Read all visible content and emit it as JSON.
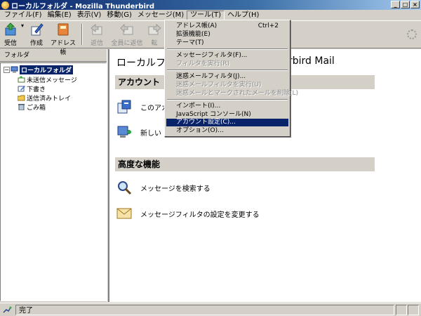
{
  "window": {
    "title": "ローカルフォルダ - Mozilla Thunderbird",
    "min": "_",
    "max": "□",
    "close": "×"
  },
  "menubar": [
    {
      "label": "ファイル(F)"
    },
    {
      "label": "編集(E)"
    },
    {
      "label": "表示(V)"
    },
    {
      "label": "移動(G)"
    },
    {
      "label": "メッセージ(M)"
    },
    {
      "label": "ツール(T)",
      "active": true
    },
    {
      "label": "ヘルプ(H)"
    }
  ],
  "toolbar": {
    "get": "受信",
    "compose": "作成",
    "address_book": "アドレス帳",
    "reply": "返信",
    "reply_all": "全員に返信",
    "forward": "転"
  },
  "folder_pane": {
    "header": "フォルダ",
    "expander": "−",
    "items": [
      "ローカルフォルダ",
      "未送信メッセージ",
      "下書き",
      "送信済みトレイ",
      "ごみ箱"
    ]
  },
  "main": {
    "title": "ローカルフ",
    "title_tail": "rbird Mail",
    "accounts_header": "アカウント",
    "account_settings_link": "このアカ",
    "new_account_link": "新しい",
    "advanced_header": "高度な機能",
    "search_link": "メッセージを検索する",
    "filters_link": "メッセージフィルタの設定を変更する"
  },
  "tools_menu": {
    "items": [
      {
        "label": "アドレス帳(A)",
        "shortcut": "Ctrl+2",
        "enabled": true
      },
      {
        "label": "拡張機能(E)",
        "enabled": true
      },
      {
        "label": "テーマ(T)",
        "enabled": true
      },
      {
        "separator": true
      },
      {
        "label": "メッセージフィルタ(F)...",
        "enabled": true
      },
      {
        "label": "フィルタを実行(R)",
        "enabled": false
      },
      {
        "separator": true
      },
      {
        "label": "迷惑メールフィルタ(J)...",
        "enabled": true
      },
      {
        "label": "迷惑メールフィルタを実行(U)",
        "enabled": false
      },
      {
        "label": "迷惑メールとマークされたメールを削除(L)",
        "enabled": false
      },
      {
        "separator": true
      },
      {
        "label": "インポート(I)...",
        "enabled": true
      },
      {
        "label": "JavaScript コンソール(N)",
        "enabled": true
      },
      {
        "separator": true
      },
      {
        "label": "アカウント設定(C)...",
        "enabled": true,
        "highlighted": true
      },
      {
        "label": "オプション(O)...",
        "enabled": true
      }
    ]
  },
  "status": {
    "text": "完了"
  },
  "colors": {
    "selection": "#0a246a",
    "face": "#d4d0c8",
    "titlebar_start": "#0a246a",
    "titlebar_end": "#a6caf0"
  }
}
